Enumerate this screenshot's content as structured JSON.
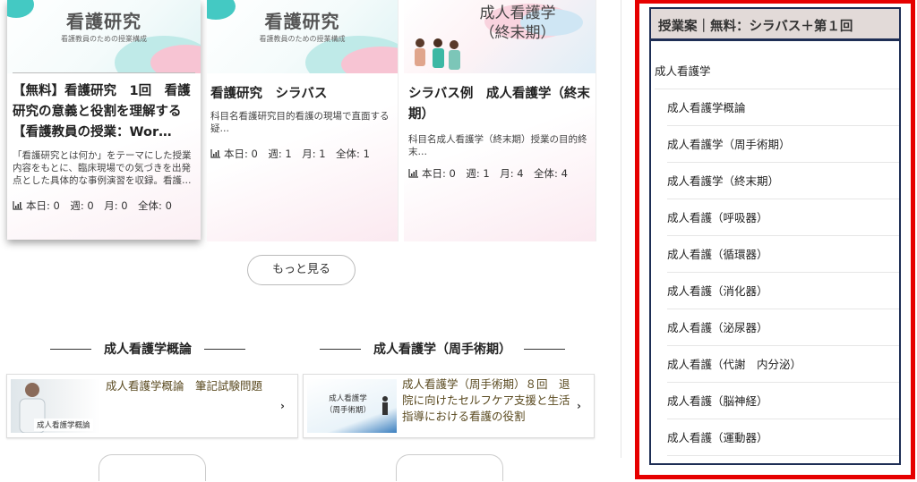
{
  "cards": [
    {
      "thumb_title": "看護研究",
      "thumb_subtitle": "看護教員のための授業構成",
      "title": "【無料】看護研究　1回　看護研究の意義と役割を理解する【看護教員の授業：Wor…",
      "description": "「看護研究とは何か」をテーマにした授業内容をもとに、臨床現場での気づきを出発点とした具体的な事例演習を収録。看護…",
      "stats": "本日: 0　週: 0　月: 0　全体: 0"
    },
    {
      "thumb_title": "看護研究",
      "thumb_subtitle": "看護教員のための授業構成",
      "title": "看護研究　シラバス",
      "description": "科目名看護研究目的看護の現場で直面する疑…",
      "stats": "本日: 0　週: 1　月: 1　全体: 1"
    },
    {
      "thumb_title_line1": "成人看護学",
      "thumb_title_line2": "（終末期）",
      "title": "シラバス例　成人看護学（終末期）",
      "description": "科目名成人看護学（終末期）授業の目的終末…",
      "stats": "本日: 0　週: 1　月: 4　全体: 4"
    }
  ],
  "more_button": "もっと見る",
  "sections": [
    {
      "heading": "成人看護学概論",
      "link_text": "成人看護学概論　筆記試験問題",
      "thumb_label": "成人看護学概論"
    },
    {
      "heading": "成人看護学（周手術期）",
      "link_text": "成人看護学（周手術期）８回　退院に向けたセルフケア支援と生活指導における看護の役割",
      "thumb_label_line1": "成人看護学",
      "thumb_label_line2": "（周手術期）"
    }
  ],
  "sidebar": {
    "title": "授業案｜無料：シラバス＋第１回",
    "root": "成人看護学",
    "items": [
      "成人看護学概論",
      "成人看護学（周手術期）",
      "成人看護学（終末期）",
      "成人看護（呼吸器）",
      "成人看護（循環器）",
      "成人看護（消化器）",
      "成人看護（泌尿器）",
      "成人看護（代謝　内分泌）",
      "成人看護（脳神経）",
      "成人看護（運動器）"
    ]
  },
  "colors": {
    "highlight_frame": "#e60000",
    "widget_border": "#1e2e55",
    "widget_header": "#e2dad8",
    "link_text": "#5a4a20",
    "thumb_teal": "#3cc7c2",
    "thumb_pink": "#f3b3c6"
  },
  "icons": {
    "stats": "bar-chart-icon",
    "arrow": "chevron-right-icon"
  }
}
